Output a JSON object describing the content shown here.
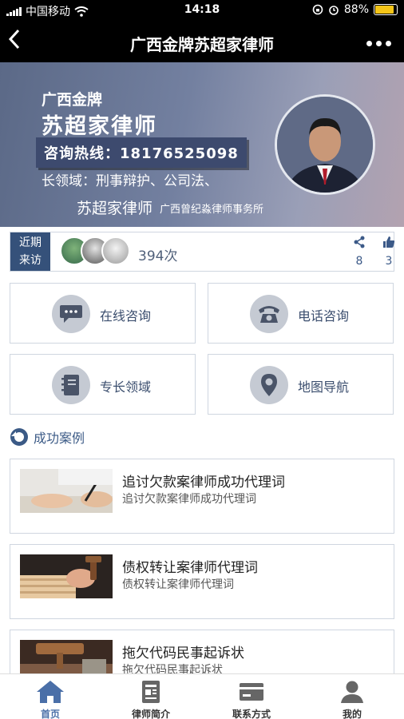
{
  "status_bar": {
    "carrier": "中国移动",
    "time": "14:18",
    "battery": "88%"
  },
  "nav": {
    "title": "广西金牌苏超家律师",
    "back_icon": "chevron-left-icon",
    "more_icon": "more-dots-icon"
  },
  "banner": {
    "subtitle": "广西金牌",
    "name": "苏超家律师",
    "hotline": "咨询热线：18176525098",
    "specialty_partial": "长领域：刑事辩护、公司法、",
    "lawyer_name": "苏超家律师",
    "firm": "广西曾纪淼律师事务所"
  },
  "visits": {
    "label_line1": "近期",
    "label_line2": "来访",
    "count": "394次",
    "share_count": "8",
    "like_count": "3"
  },
  "actions": [
    {
      "label": "在线咨询",
      "icon": "chat-bubble-icon"
    },
    {
      "label": "电话咨询",
      "icon": "telephone-icon"
    },
    {
      "label": "专长领域",
      "icon": "notebook-icon"
    },
    {
      "label": "地图导航",
      "icon": "map-pin-icon"
    }
  ],
  "section": {
    "title": "成功案例",
    "icon": "section-icon"
  },
  "cases": [
    {
      "title": "追讨欠款案律师成功代理词",
      "subtitle": "追讨欠款案律师成功代理词"
    },
    {
      "title": "债权转让案律师代理词",
      "subtitle": "债权转让案律师代理词"
    },
    {
      "title": "拖欠代码民事起诉状",
      "subtitle": "拖欠代码民事起诉状"
    }
  ],
  "tabs": [
    {
      "label": "首页",
      "icon": "home-icon",
      "active": true
    },
    {
      "label": "律师简介",
      "icon": "profile-doc-icon",
      "active": false
    },
    {
      "label": "联系方式",
      "icon": "contact-card-icon",
      "active": false
    },
    {
      "label": "我的",
      "icon": "user-icon",
      "active": false
    }
  ],
  "colors": {
    "accent": "#35517a",
    "icon_gray": "#c5cad3",
    "tab_active": "#4a6fa8"
  }
}
